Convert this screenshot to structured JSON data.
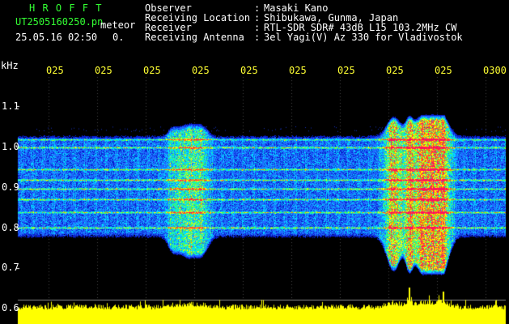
{
  "header": {
    "logo": "H R O F F T",
    "filename": "UT2505160250.pn",
    "mode": "meteor",
    "datetime": "25.05.16 02:50",
    "counter": "0.",
    "fields": [
      {
        "label": "Observer",
        "value": "Masaki Kano"
      },
      {
        "label": "Receiving Location",
        "value": "Shibukawa, Gunma, Japan"
      },
      {
        "label": "Receiver",
        "value": "RTL-SDR SDR# 43dB L15 103.2MHz CW"
      },
      {
        "label": "Receiving Antenna",
        "value": "3el Yagi(V) Az 330 for Vladivostok"
      }
    ],
    "separator": ":"
  },
  "axis": {
    "unit": "kHz",
    "y_labels": [
      "1.1",
      "1.0",
      "0.9",
      "0.8",
      "0.7",
      "0.6"
    ],
    "time_labels": [
      "025",
      "025",
      "025",
      "025",
      "025",
      "025",
      "025",
      "025",
      "025",
      "0300"
    ]
  },
  "colors": {
    "background": "#000000",
    "label_white": "#ffffff",
    "label_green": "#33ff33",
    "label_yellow": "#ffff33",
    "band_low": "#0000cc",
    "band_mid": "#00ffff",
    "band_high": "#ffff00",
    "band_peak": "#ff0066",
    "power_trace": "#ffff00"
  }
}
